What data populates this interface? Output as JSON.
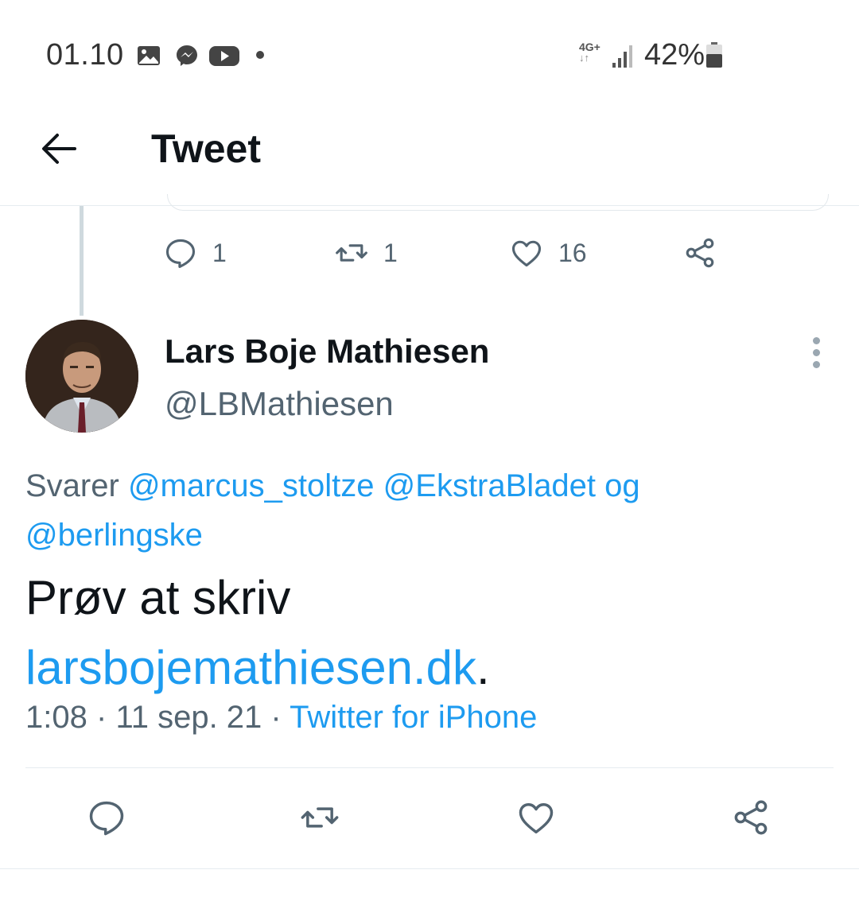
{
  "status_bar": {
    "time": "01.10",
    "network": "4G+",
    "battery_percent": "42%",
    "notification_icons": [
      "gallery-icon",
      "messenger-icon",
      "youtube-icon"
    ]
  },
  "header": {
    "back_icon": "arrow-left-icon",
    "title": "Tweet"
  },
  "previous_tweet": {
    "replies": "1",
    "retweets": "1",
    "likes": "16"
  },
  "tweet": {
    "author_name": "Lars Boje Mathiesen",
    "author_handle": "@LBMathiesen",
    "reply_prefix": "Svarer",
    "mention_1": "@marcus_stoltze",
    "mention_2": "@EkstraBladet",
    "reply_connector": "og",
    "mention_3": "@berlingske",
    "text": "Prøv at skriv",
    "link": "larsbojemathiesen.dk",
    "text_suffix": ".",
    "time": "1:08",
    "date": "11 sep. 21",
    "separator": "·",
    "source": "Twitter for iPhone"
  },
  "colors": {
    "accent": "#1d9bf0",
    "secondary_text": "#536471",
    "primary_text": "#0f1419"
  }
}
